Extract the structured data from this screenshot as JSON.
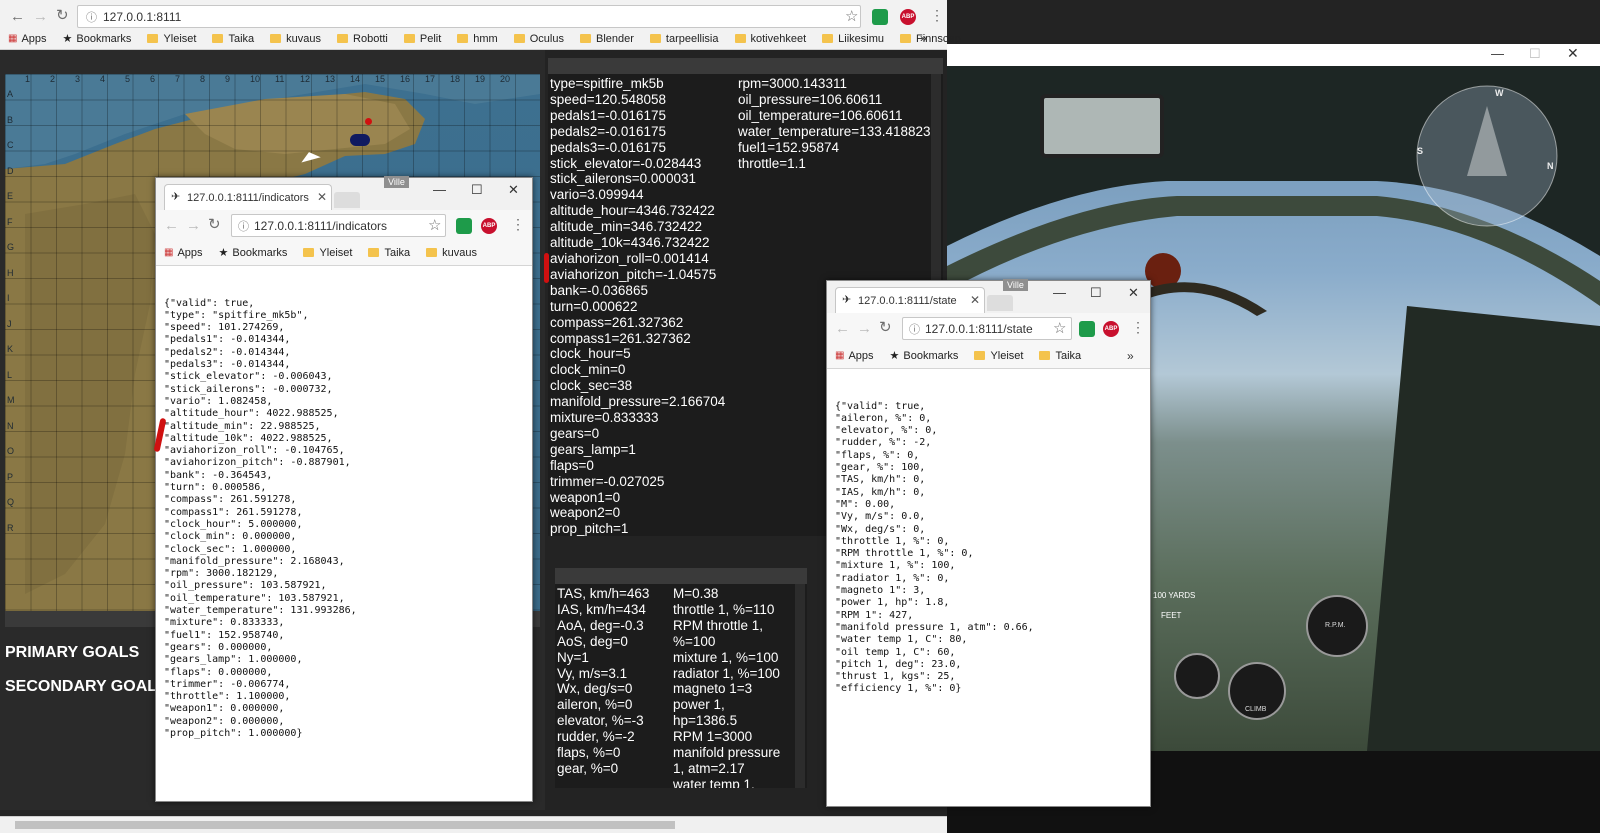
{
  "main_browser": {
    "url": "127.0.0.1:8111",
    "bookmarks": [
      "Apps",
      "Bookmarks",
      "Yleiset",
      "Taika",
      "kuvaus",
      "Robotti",
      "Pelit",
      "hmm",
      "Oculus",
      "Blender",
      "tarpeellisia",
      "kotivehkeet",
      "Liikesimu",
      "Finnscep"
    ],
    "more": "»"
  },
  "map": {
    "col_labels": [
      "1",
      "2",
      "3",
      "4",
      "5",
      "6",
      "7",
      "8",
      "9",
      "10",
      "11",
      "12",
      "13",
      "14",
      "15",
      "16",
      "17",
      "18",
      "19",
      "20"
    ],
    "row_labels": [
      "A",
      "B",
      "C",
      "D",
      "E",
      "F",
      "G",
      "H",
      "I",
      "J",
      "K",
      "L",
      "M",
      "N",
      "O",
      "P",
      "Q",
      "R"
    ],
    "primary_goals": "PRIMARY GOALS",
    "secondary_goals": "SECONDARY GOALS"
  },
  "indicators_panel": {
    "left": [
      "type=spitfire_mk5b",
      "speed=120.548058",
      "pedals1=-0.016175",
      "pedals2=-0.016175",
      "pedals3=-0.016175",
      "stick_elevator=-0.028443",
      "stick_ailerons=0.000031",
      "vario=3.099944",
      "altitude_hour=4346.732422",
      "altitude_min=346.732422",
      "altitude_10k=4346.732422",
      "aviahorizon_roll=0.001414",
      "aviahorizon_pitch=-1.04575",
      "bank=-0.036865",
      "turn=0.000622",
      "compass=261.327362",
      "compass1=261.327362",
      "clock_hour=5",
      "clock_min=0",
      "clock_sec=38",
      "manifold_pressure=2.166704",
      "mixture=0.833333",
      "gears=0",
      "gears_lamp=1",
      "flaps=0",
      "trimmer=-0.027025",
      "weapon1=0",
      "weapon2=0",
      "prop_pitch=1"
    ],
    "right": [
      "rpm=3000.143311",
      "oil_pressure=106.60611",
      "oil_temperature=106.60611",
      "water_temperature=133.418823",
      "fuel1=152.95874",
      "throttle=1.1"
    ]
  },
  "state_panel": {
    "left": [
      "TAS, km/h=463",
      "IAS, km/h=434",
      "AoA, deg=-0.3",
      "AoS, deg=0",
      "Ny=1",
      "Vy, m/s=3.1",
      "Wx, deg/s=0",
      "aileron, %=0",
      "elevator, %=-3",
      "rudder, %=-2",
      "flaps, %=0",
      "gear, %=0"
    ],
    "right": [
      "M=0.38",
      "throttle 1, %=110",
      "RPM throttle 1,",
      "%=100",
      "mixture 1, %=100",
      "radiator 1, %=100",
      "magneto 1=3",
      "power 1,",
      "hp=1386.5",
      "RPM 1=3000",
      "manifold pressure",
      "1, atm=2.17",
      "water temp 1,"
    ]
  },
  "win_indicators": {
    "tab_title": "127.0.0.1:8111/indicators",
    "url": "127.0.0.1:8111/indicators",
    "bookmarks": [
      "Apps",
      "Bookmarks",
      "Yleiset",
      "Taika",
      "kuvaus"
    ],
    "user": "Ville",
    "json_lines": [
      "{\"valid\": true,",
      "\"type\": \"spitfire_mk5b\",",
      "\"speed\": 101.274269,",
      "\"pedals1\": -0.014344,",
      "\"pedals2\": -0.014344,",
      "\"pedals3\": -0.014344,",
      "\"stick_elevator\": -0.006043,",
      "\"stick_ailerons\": -0.000732,",
      "\"vario\": 1.082458,",
      "\"altitude_hour\": 4022.988525,",
      "\"altitude_min\": 22.988525,",
      "\"altitude_10k\": 4022.988525,",
      "\"aviahorizon_roll\": -0.104765,",
      "\"aviahorizon_pitch\": -0.887901,",
      "\"bank\": -0.364543,",
      "\"turn\": 0.000586,",
      "\"compass\": 261.591278,",
      "\"compass1\": 261.591278,",
      "\"clock_hour\": 5.000000,",
      "\"clock_min\": 0.000000,",
      "\"clock_sec\": 1.000000,",
      "\"manifold_pressure\": 2.168043,",
      "\"rpm\": 3000.182129,",
      "\"oil_pressure\": 103.587921,",
      "\"oil_temperature\": 103.587921,",
      "\"water_temperature\": 131.993286,",
      "\"mixture\": 0.833333,",
      "\"fuel1\": 152.958740,",
      "\"gears\": 0.000000,",
      "\"gears_lamp\": 1.000000,",
      "\"flaps\": 0.000000,",
      "\"trimmer\": -0.006774,",
      "\"throttle\": 1.100000,",
      "\"weapon1\": 0.000000,",
      "\"weapon2\": 0.000000,",
      "\"prop_pitch\": 1.000000}"
    ]
  },
  "win_state": {
    "tab_title": "127.0.0.1:8111/state",
    "url": "127.0.0.1:8111/state",
    "bookmarks": [
      "Apps",
      "Bookmarks",
      "Yleiset",
      "Taika"
    ],
    "user": "Ville",
    "json_lines": [
      "{\"valid\": true,",
      "\"aileron, %\": 0,",
      "\"elevator, %\": 0,",
      "\"rudder, %\": -2,",
      "\"flaps, %\": 0,",
      "\"gear, %\": 100,",
      "\"TAS, km/h\": 0,",
      "\"IAS, km/h\": 0,",
      "\"M\": 0.00,",
      "\"Vy, m/s\": 0.0,",
      "\"Wx, deg/s\": 0,",
      "\"throttle 1, %\": 0,",
      "\"RPM throttle 1, %\": 0,",
      "\"mixture 1, %\": 100,",
      "\"radiator 1, %\": 0,",
      "\"magneto 1\": 3,",
      "\"power 1, hp\": 1.8,",
      "\"RPM 1\": 427,",
      "\"manifold pressure 1, atm\": 0.66,",
      "\"water temp 1, C\": 80,",
      "\"oil temp 1, C\": 60,",
      "\"pitch 1, deg\": 23.0,",
      "\"thrust 1, kgs\": 25,",
      "\"efficiency 1, %\": 0}"
    ]
  },
  "cockpit": {
    "compass_letters": [
      "W",
      "S",
      "N"
    ],
    "gauge_labels": [
      "100 YARDS",
      "FEET",
      "CLIMB",
      "R.P.M."
    ]
  },
  "colors": {
    "bg": "#232323",
    "map_sea": "#3a6c8a",
    "map_land": "#8c7a46",
    "accent_red": "#c8102e",
    "ext_green": "#1e9b4a"
  }
}
